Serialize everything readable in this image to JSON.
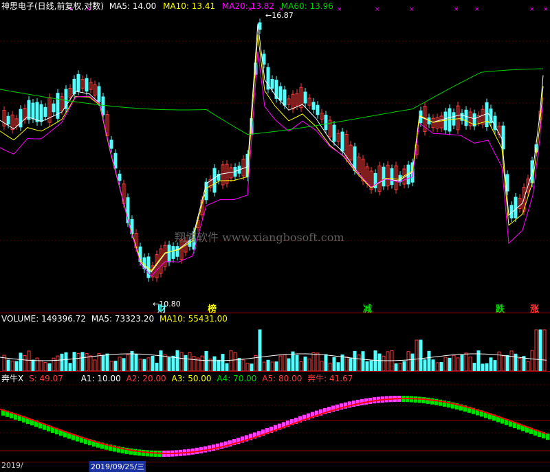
{
  "price_panel": {
    "name": "神思电子(日线,前复权,对数)",
    "ma5": "MA5: 14.00",
    "ma10": "MA10: 13.41",
    "ma20": "MA20: 13.82",
    "ma60": "MA60: 13.96",
    "high_label": "16.87",
    "low_label": "10.80",
    "watermark": "翔博软件 www.xiangbosoft.com",
    "signals": [
      "榜",
      "减",
      "跌",
      "涨"
    ],
    "signal_extra": "财"
  },
  "volume_panel": {
    "volume": "VOLUME: 149396.72",
    "ma5": "MA5: 73323.20",
    "ma10": "MA10: 55431.00"
  },
  "indicator_panel": {
    "name": "奔牛X",
    "s": "S: 49.07",
    "a1": "A1: 10.00",
    "a2": "A2: 20.00",
    "a3": "A3: 50.00",
    "a4": "A4: 70.00",
    "a5": "A5: 80.00",
    "bull": "奔牛: 41.67"
  },
  "date_axis": {
    "left_label": "2019/",
    "selected_date": "2019/09/25/三"
  },
  "colors": {
    "up": "#ff3c3c",
    "down": "#54ffff",
    "ma5": "#ffffff",
    "ma10": "#ffff00",
    "ma20": "#ff00ff",
    "ma60": "#00d000",
    "grid": "#b00000",
    "osc_up": "#ff40ff",
    "osc_down": "#00e000",
    "osc_line": "#ff0000"
  }
}
